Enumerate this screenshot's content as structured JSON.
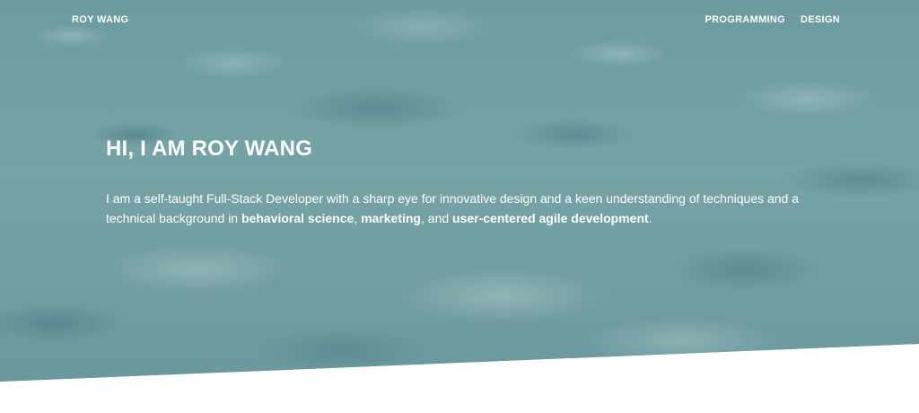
{
  "nav": {
    "logo": "ROY WANG",
    "links": [
      "PROGRAMMING",
      "DESIGN"
    ]
  },
  "hero": {
    "title": "HI, I AM ROY WANG",
    "intro": {
      "part1": "I am a self-taught Full-Stack Developer with a sharp eye for innovative design and a keen understanding of techniques and a technical background in ",
      "strong1": "behavioral science",
      "sep1": ", ",
      "strong2": "marketing",
      "sep2": ", and ",
      "strong3": "user-centered agile development",
      "end": "."
    }
  },
  "colors": {
    "hero_background": "#6f9ea1",
    "text": "#ffffff",
    "page_background": "#ffffff"
  }
}
